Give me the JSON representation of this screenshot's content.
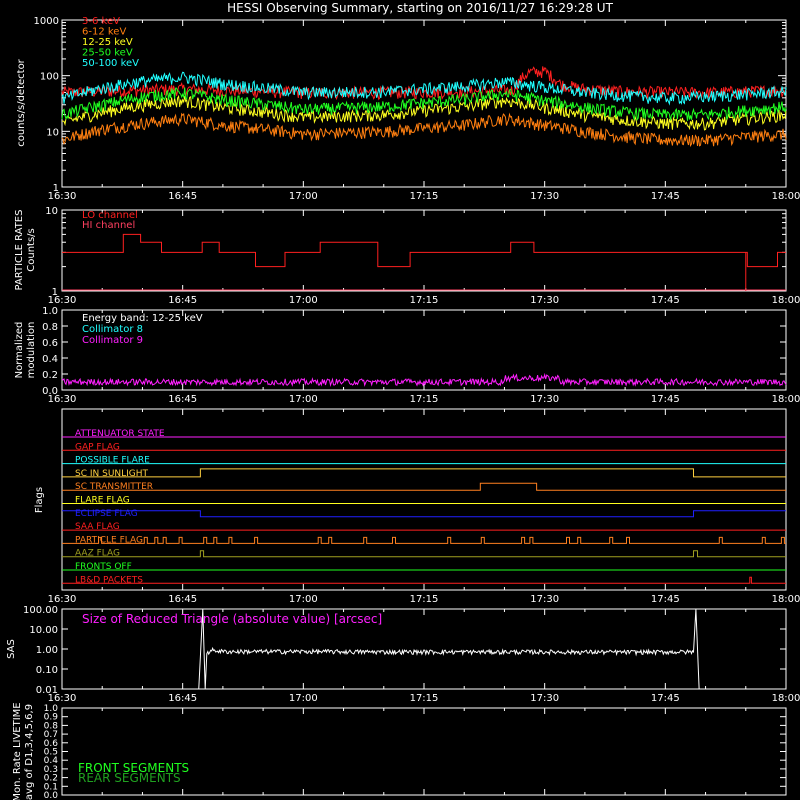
{
  "title": "HESSI Observing Summary, starting on 2016/11/27 16:29:28 UT",
  "chart_data": [
    {
      "type": "line",
      "panel": "count-rates",
      "ylabel": "counts/s/detector",
      "yscale": "log",
      "ylim": [
        1,
        1000
      ],
      "y_ticks": [
        "1",
        "10",
        "100",
        "1000"
      ],
      "x_ticks": [
        "16:30",
        "16:45",
        "17:00",
        "17:15",
        "17:30",
        "17:45",
        "18:00"
      ],
      "xlim_minutes": [
        0,
        90
      ],
      "series": [
        {
          "name": "3-6 keV",
          "color": "#ff2020",
          "x": [
            0,
            10,
            15,
            20,
            30,
            40,
            50,
            56,
            58,
            60,
            62,
            65,
            70,
            80,
            90
          ],
          "y": [
            50,
            55,
            58,
            55,
            50,
            50,
            52,
            55,
            115,
            120,
            70,
            58,
            52,
            50,
            55
          ]
        },
        {
          "name": "6-12 keV",
          "color": "#ff7f10",
          "x": [
            0,
            5,
            10,
            15,
            20,
            30,
            40,
            50,
            55,
            60,
            65,
            70,
            75,
            80,
            90
          ],
          "y": [
            7,
            11,
            14,
            17,
            13,
            9,
            10,
            13,
            17,
            13,
            10,
            8,
            7,
            7,
            9
          ]
        },
        {
          "name": "12-25 keV",
          "color": "#ffff20",
          "x": [
            0,
            5,
            10,
            15,
            20,
            30,
            40,
            50,
            55,
            60,
            65,
            70,
            75,
            80,
            90
          ],
          "y": [
            14,
            22,
            30,
            36,
            27,
            18,
            20,
            28,
            36,
            27,
            20,
            16,
            14,
            14,
            20
          ]
        },
        {
          "name": "25-50 keV",
          "color": "#20ff20",
          "x": [
            0,
            5,
            10,
            15,
            20,
            30,
            40,
            50,
            55,
            60,
            65,
            70,
            75,
            80,
            90
          ],
          "y": [
            20,
            30,
            42,
            50,
            37,
            25,
            28,
            38,
            48,
            36,
            27,
            22,
            20,
            20,
            28
          ]
        },
        {
          "name": "50-100 keV",
          "color": "#20ffff",
          "x": [
            0,
            5,
            10,
            15,
            20,
            30,
            40,
            50,
            55,
            60,
            65,
            70,
            75,
            80,
            90
          ],
          "y": [
            38,
            60,
            80,
            95,
            72,
            50,
            52,
            65,
            78,
            62,
            50,
            44,
            40,
            42,
            52
          ]
        }
      ]
    },
    {
      "type": "line",
      "panel": "particle-rates",
      "ylabel": "PARTICLE RATES",
      "ylabel2": "Counts/s",
      "yscale": "log",
      "ylim": [
        1,
        10
      ],
      "y_ticks": [
        "1",
        "10"
      ],
      "series": [
        {
          "name": "LO channel",
          "color": "#ff2020"
        },
        {
          "name": "HI channel",
          "color": "#ff4060"
        }
      ]
    },
    {
      "type": "line",
      "panel": "modulation",
      "ylabel": "Normalized",
      "ylabel2": "modulation",
      "ylim": [
        0,
        1
      ],
      "y_ticks": [
        "0.0",
        "0.2",
        "0.4",
        "0.6",
        "0.8",
        "1.0"
      ],
      "annotation": "Energy band: 12-25 keV",
      "series": [
        {
          "name": "Collimator 8",
          "color": "#20ffff"
        },
        {
          "name": "Collimator 9",
          "color": "#ff20ff"
        }
      ]
    },
    {
      "type": "line",
      "panel": "flags",
      "ylabel": "Flags",
      "flags": [
        {
          "name": "ATTENUATOR STATE",
          "color": "#ff20ff"
        },
        {
          "name": "GAP FLAG",
          "color": "#ff2020"
        },
        {
          "name": "POSSIBLE FLARE",
          "color": "#20ffff"
        },
        {
          "name": "SC IN SUNLIGHT",
          "color": "#ffd040"
        },
        {
          "name": "SC TRANSMITTER",
          "color": "#ff8020"
        },
        {
          "name": "FLARE FLAG",
          "color": "#ffff20"
        },
        {
          "name": "ECLIPSE FLAG",
          "color": "#2020ff"
        },
        {
          "name": "SAA FLAG",
          "color": "#ff2020"
        },
        {
          "name": "PARTICLE FLAG",
          "color": "#ff8020"
        },
        {
          "name": "AAZ FLAG",
          "color": "#a0a020"
        },
        {
          "name": "FRONTS OFF",
          "color": "#20ff20"
        },
        {
          "name": "LB&D PACKETS",
          "color": "#ff2020"
        }
      ]
    },
    {
      "type": "line",
      "panel": "sas",
      "ylabel": "SAS",
      "yscale": "log",
      "ylim": [
        0.01,
        100
      ],
      "y_ticks": [
        "0.01",
        "0.10",
        "1.00",
        "10.00",
        "100.00"
      ],
      "annotation": "Size of Reduced Triangle (absolute value) [arcsec]",
      "series": [
        {
          "name": "",
          "color": "#ffffff",
          "x": [
            17,
            17.6,
            18.5,
            20,
            30,
            40,
            50,
            60,
            70,
            78,
            79.5
          ],
          "y": [
            0.8,
            100,
            0.9,
            0.75,
            0.75,
            0.72,
            0.72,
            0.72,
            0.7,
            0.72,
            100
          ]
        }
      ]
    },
    {
      "type": "line",
      "panel": "livetime",
      "ylabel": "Mon. Rate LIVETIME",
      "ylabel2": "avg of D1,3,4,5,6,9",
      "ylim": [
        0,
        1
      ],
      "y_ticks": [
        "0.0",
        "0.1",
        "0.2",
        "0.3",
        "0.4",
        "0.5",
        "0.6",
        "0.7",
        "0.8",
        "0.9",
        "1.0"
      ],
      "series": [
        {
          "name": "FRONT SEGMENTS",
          "color": "#20ff20"
        },
        {
          "name": "REAR SEGMENTS",
          "color": "#20a020"
        }
      ]
    }
  ]
}
